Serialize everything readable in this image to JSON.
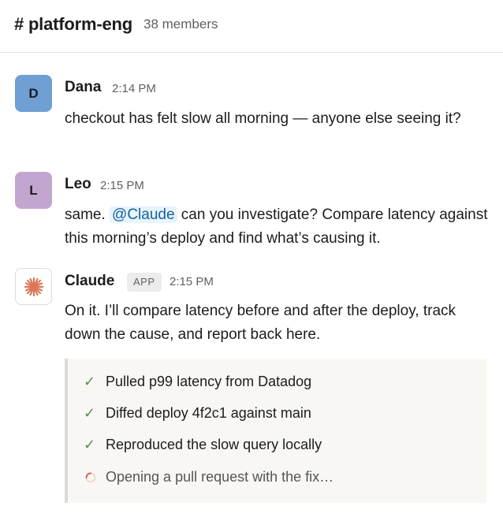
{
  "channel": {
    "name": "# platform-eng",
    "members": "38 members"
  },
  "messages": [
    {
      "author": "Dana",
      "initial": "D",
      "time": "2:14 PM",
      "text": "checkout has felt slow all morning — anyone else seeing it?"
    },
    {
      "author": "Leo",
      "initial": "L",
      "time": "2:15 PM",
      "text_before": "same. ",
      "mention": "@Claude",
      "text_after": " can you investigate? Compare latency against this morning’s deploy and find what’s causing it."
    },
    {
      "author": "Claude",
      "badge": "APP",
      "time": "2:15 PM",
      "text": "On it. I’ll compare latency before and after the deploy, track down the cause, and report back here."
    }
  ],
  "tasks": [
    {
      "label": "Pulled p99 latency from Datadog",
      "status": "done"
    },
    {
      "label": "Diffed deploy 4f2c1 against main",
      "status": "done"
    },
    {
      "label": "Reproduced the slow query locally",
      "status": "done"
    },
    {
      "label": "Opening a pull request with the fix…",
      "status": "in-progress"
    }
  ],
  "icons": {
    "done": "checkmark-icon",
    "in_progress": "spinner-icon",
    "claude_avatar": "claude-asterisk-icon"
  },
  "colors": {
    "dana_avatar": "#6f9fd3",
    "leo_avatar": "#c3a6cf",
    "claude_accent": "#d97757",
    "mention_bg": "#e8f3fb",
    "mention_text": "#1264a3",
    "check": "#5a8a5e"
  }
}
